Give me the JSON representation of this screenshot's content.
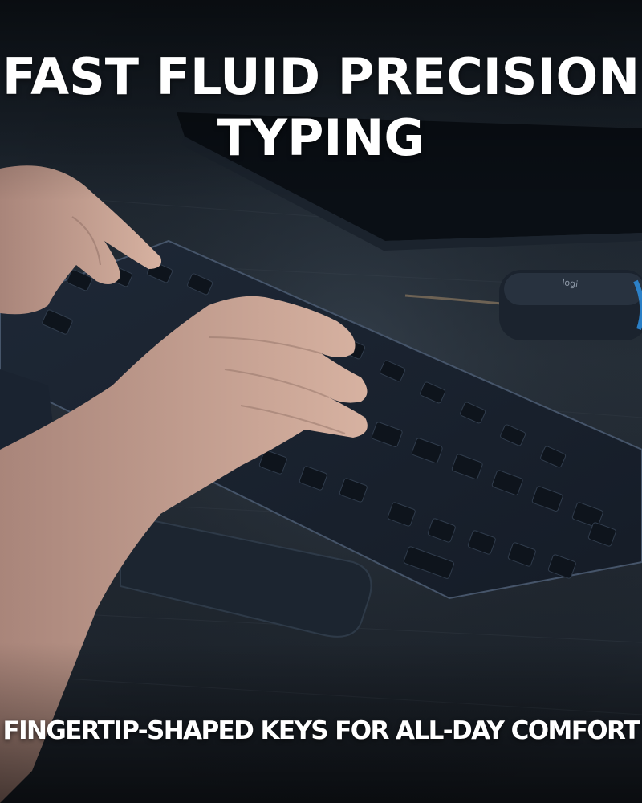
{
  "headline": {
    "line1": "FAST FLUID PRECISION",
    "line2": "TYPING"
  },
  "tagline": "FINGERTIP-SHAPED KEYS FOR ALL-DAY COMFORT",
  "brand_mark": "logi",
  "colors": {
    "text": "#ffffff",
    "background": "#0d141c",
    "desk": "#2a3038",
    "keyboard": "#1a2230",
    "accent": "#2d8fe0"
  }
}
